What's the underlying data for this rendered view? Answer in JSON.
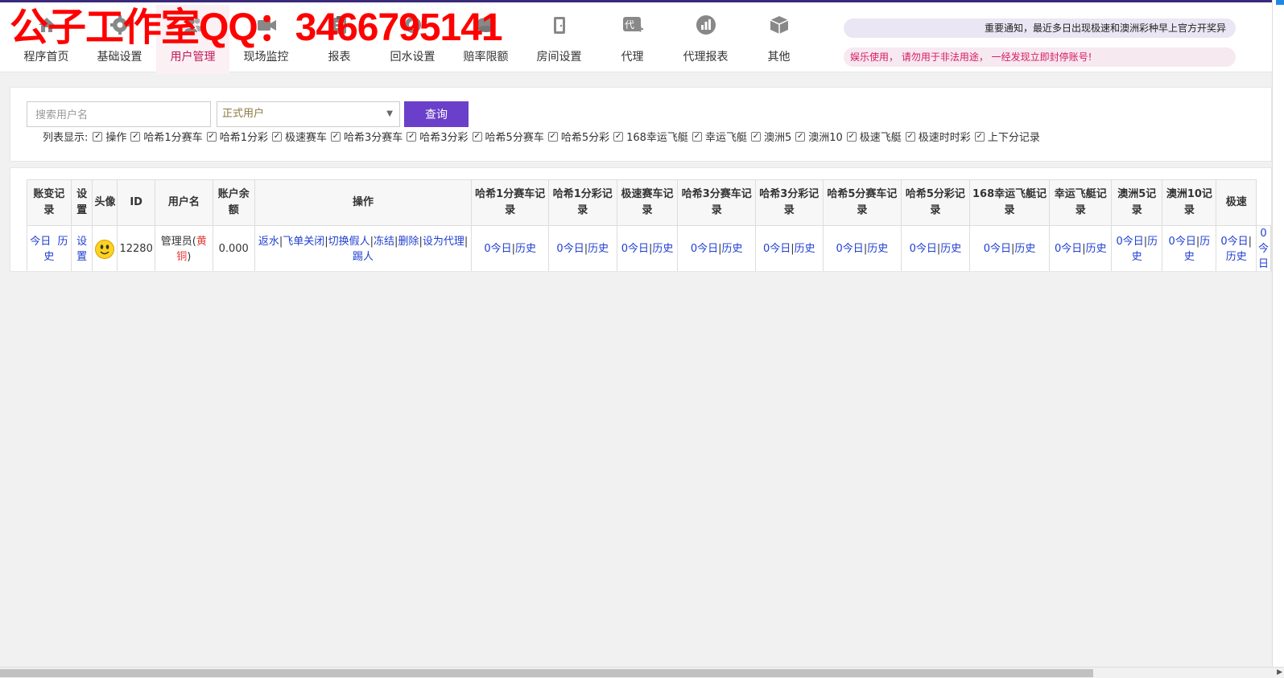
{
  "watermark": "公子工作室QQ：3466795141",
  "nav": [
    {
      "label": "程序首页",
      "icon": "home-icon",
      "name": "home"
    },
    {
      "label": "基础设置",
      "icon": "gear-icon",
      "name": "basic-settings"
    },
    {
      "label": "用户管理",
      "icon": "users-icon",
      "name": "user-management"
    },
    {
      "label": "现场监控",
      "icon": "video-icon",
      "name": "live-monitor"
    },
    {
      "label": "报表",
      "icon": "clipboard-icon",
      "name": "reports"
    },
    {
      "label": "回水设置",
      "icon": "refresh-icon",
      "name": "rebate-settings"
    },
    {
      "label": "赔率限额",
      "icon": "coins-icon",
      "name": "odds-limits"
    },
    {
      "label": "房间设置",
      "icon": "door-icon",
      "name": "room-settings"
    },
    {
      "label": "代理",
      "icon": "agent-icon",
      "name": "agent"
    },
    {
      "label": "代理报表",
      "icon": "chart-icon",
      "name": "agent-reports"
    },
    {
      "label": "其他",
      "icon": "box-icon",
      "name": "other"
    }
  ],
  "active_nav": 2,
  "notices": {
    "line1": "重要通知，最近多日出现极速和澳洲彩种早上官方开奖异",
    "line2": "娱乐使用， 请勿用于非法用途， 一经发现立即封停账号!"
  },
  "search": {
    "placeholder": "搜索用户名",
    "user_type": "正式用户",
    "query_label": "查询"
  },
  "column_display": {
    "label": "列表显示:",
    "options": [
      "操作",
      "哈希1分赛车",
      "哈希1分彩",
      "极速赛车",
      "哈希3分赛车",
      "哈希3分彩",
      "哈希5分赛车",
      "哈希5分彩",
      "168幸运飞艇",
      "幸运飞艇",
      "澳洲5",
      "澳洲10",
      "极速飞艇",
      "极速时时彩",
      "上下分记录"
    ]
  },
  "table": {
    "headers": [
      "账变记录",
      "设置",
      "头像",
      "ID",
      "用户名",
      "账户余额",
      "操作",
      "哈希1分赛车记录",
      "哈希1分彩记录",
      "极速赛车记录",
      "哈希3分赛车记录",
      "哈希3分彩记录",
      "哈希5分赛车记录",
      "哈希5分彩记录",
      "168幸运飞艇记录",
      "幸运飞艇记录",
      "澳洲5记录",
      "澳洲10记录",
      "极速"
    ],
    "row": {
      "today": "今日",
      "history": "历史",
      "settings": "设置",
      "avatar": "smiley-avatar-icon",
      "id": "12280",
      "username": "管理员",
      "level": "黄铜",
      "balance": "0.000",
      "actions": [
        "返水",
        "飞单关闭",
        "切换假人",
        "冻结",
        "删除",
        "设为代理",
        "踢人"
      ],
      "record_count": "0",
      "record_today": "今日",
      "record_history": "历史",
      "last_partial": "0今日"
    }
  },
  "colors": {
    "accent": "#6a3fc9",
    "active_nav": "#c2185b",
    "link": "#1f3fd1",
    "watermark": "#ff0000"
  }
}
